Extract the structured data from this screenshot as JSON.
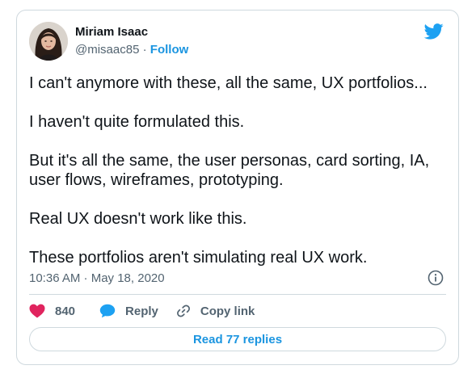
{
  "author": {
    "name": "Miriam Isaac",
    "handle": "@misaac85",
    "separator": " · ",
    "follow_label": "Follow"
  },
  "tweet": {
    "paragraphs": [
      "I can't anymore with these, all the same, UX portfolios...",
      "I haven't quite formulated this.",
      "But it's all the same, the user personas, card sorting, IA, user flows, wireframes, prototyping.",
      "Real UX doesn't work like this.",
      "These portfolios aren't simulating real UX work."
    ],
    "timestamp": "10:36 AM · May 18, 2020"
  },
  "actions": {
    "like_count": "840",
    "reply_label": "Reply",
    "copy_link_label": "Copy link"
  },
  "read_replies_label": "Read 77 replies",
  "colors": {
    "accent": "#1b95e0",
    "like": "#e0245e",
    "twitter_blue": "#1da1f2",
    "muted_text": "#536471",
    "border": "#cfd9de"
  },
  "icons": {
    "logo": "twitter-bird-icon",
    "like": "heart-icon",
    "reply": "speech-bubble-icon",
    "copy_link": "link-icon",
    "info": "info-icon"
  }
}
